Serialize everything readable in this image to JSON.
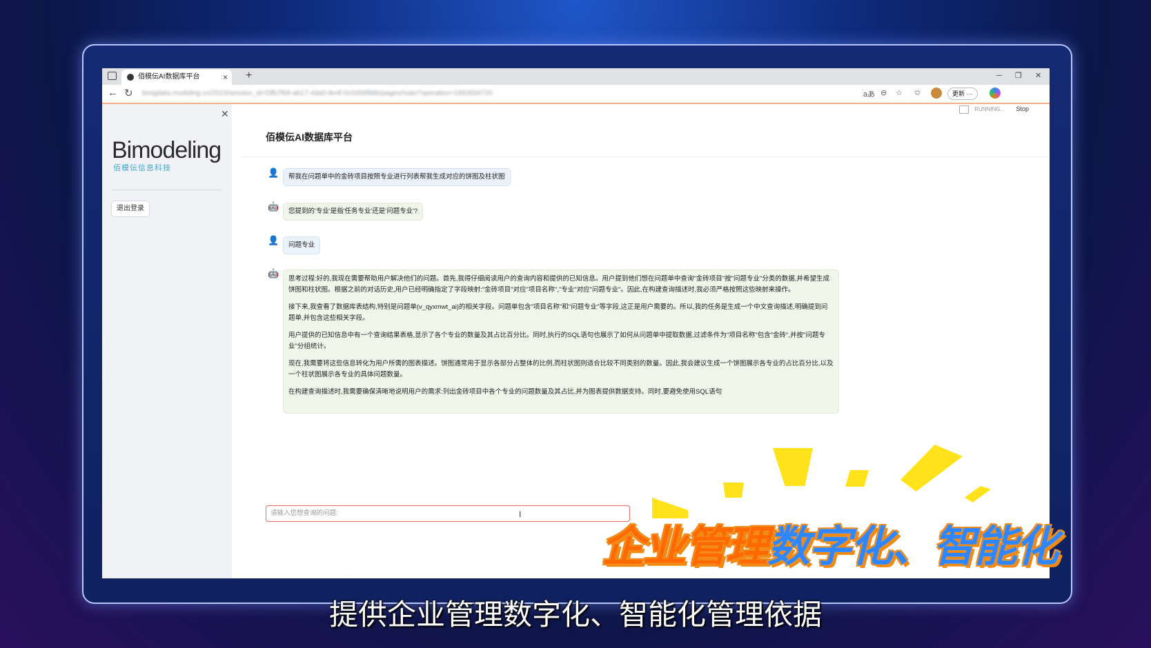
{
  "browser": {
    "tab_title": "佰模伝AI数据库平台",
    "new_tab": "+",
    "url": "bimgdata.modeling.cn/2023/session_id=f3fb7f69-ab17-4da0-9e4f-0c0358f88b/pages/main?operation=1683934720",
    "update_label": "更新",
    "more_label": "···",
    "minimize": "─",
    "restore": "❐",
    "close": "✕"
  },
  "sidebar": {
    "logo_text": "Bimodeling",
    "logo_sub": "佰模伝信息科技",
    "logout_label": "退出登录"
  },
  "app": {
    "status_running": "RUNNING...",
    "status_stop": "Stop",
    "title": "佰模伝AI数据库平台",
    "input_placeholder": "请输入您想查询的问题:"
  },
  "messages": [
    {
      "role": "user",
      "text": "帮我在问题单中的金砖项目按照专业进行列表帮我生成对应的饼图及柱状图"
    },
    {
      "role": "bot",
      "text": "您提到的'专业'是指'任务专业'还是'问题专业'?"
    },
    {
      "role": "user",
      "text": "问题专业"
    },
    {
      "role": "bot",
      "paragraphs": [
        "思考过程:好的,我现在需要帮助用户解决他们的问题。首先,我得仔细阅读用户的查询内容和提供的已知信息。用户提到他们想在问题单中查询\"金砖项目\"按\"问题专业\"分类的数据,并希望生成饼图和柱状图。根据之前的对话历史,用户已经明确指定了字段映射:\"金砖项目\"对应\"项目名称\",\"专业\"对应\"问题专业\"。因此,在构建查询描述时,我必须严格按照这些映射来操作。",
        "接下来,我查看了数据库表结构,特别是问题单(v_qyxmwt_ai)的相关字段。问题单包含\"项目名称\"和\"问题专业\"等字段,这正是用户需要的。所以,我的任务是生成一个中文查询描述,明确提到问题单,并包含这些相关字段。",
        "用户提供的已知信息中有一个查询结果表格,显示了各个专业的数量及其占比百分比。同时,执行的SQL语句也展示了如何从问题单中提取数据,过滤条件为\"项目名称\"包含\"金砖\",并按\"问题专业\"分组统计。",
        "现在,我需要将这些信息转化为用户所需的图表描述。饼图通常用于显示各部分占整体的比例,而柱状图则适合比较不同类别的数量。因此,我会建议生成一个饼图展示各专业的占比百分比,以及一个柱状图展示各专业的具体问题数量。",
        "在构建查询描述时,我需要确保清晰地说明用户的需求:列出金砖项目中各个专业的问题数量及其占比,并为图表提供数据支持。同时,要避免使用SQL语句"
      ]
    }
  ],
  "overlay": {
    "promo_part1": "企业管理",
    "promo_part2": "数字化、",
    "promo_part3": "智能化",
    "subtitle": "提供企业管理数字化、智能化管理依据"
  },
  "colors": {
    "user_bubble": "#eaf2fb",
    "bot_bubble": "#f1f6ea",
    "promo_orange": "#ff6a00",
    "promo_blue": "#2f86ff",
    "ray_yellow": "#ffe21a"
  }
}
